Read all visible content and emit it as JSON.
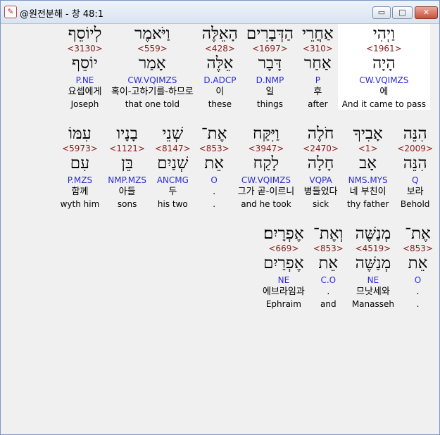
{
  "window": {
    "title": "@원전분해 - 창 48:1",
    "app_icon": "app-logo-icon",
    "min_icon": "minimize-icon",
    "max_icon": "maximize-icon",
    "close_icon": "close-icon",
    "min_glyph": "▭",
    "max_glyph": "□",
    "close_glyph": "✕"
  },
  "rows": [
    {
      "words": [
        {
          "heb": "וַיְהִי",
          "strong": "<1961>",
          "lex": "הָיָה",
          "morph": "CW.VQIMZS",
          "ko": "에",
          "en": "And it came to pass"
        },
        {
          "heb": "אַחֲרֵי",
          "strong": "<310>",
          "lex": "אַחַר",
          "morph": "P",
          "ko": "후",
          "en": "after"
        },
        {
          "heb": "הַדְּבָרִים",
          "strong": "<1697>",
          "lex": "דָּבָר",
          "morph": "D.NMP",
          "ko": "일",
          "en": "things"
        },
        {
          "heb": "הָאֵלֶּה",
          "strong": "<428>",
          "lex": "אֵלֶּה",
          "morph": "D.ADCP",
          "ko": "이",
          "en": "these"
        },
        {
          "heb": "וַיֹּאמֶר",
          "strong": "<559>",
          "lex": "אָמַר",
          "morph": "CW.VQIMZS",
          "ko": "혹이-고하기를-하므로",
          "en": "that one told"
        },
        {
          "heb": "לְיוֹסֵף",
          "strong": "<3130>",
          "lex": "יוֹסֵף",
          "morph": "P.NE",
          "ko": "요셉에게",
          "en": "Joseph"
        }
      ]
    },
    {
      "words": [
        {
          "heb": "הִנֵּה",
          "strong": "<2009>",
          "lex": "הִנֵּה",
          "morph": "Q",
          "ko": "보라",
          "en": "Behold"
        },
        {
          "heb": "אָבִיךָ",
          "strong": "<1>",
          "lex": "אָב",
          "morph": "NMS.MYS",
          "ko": "네 부친이",
          "en": "thy father"
        },
        {
          "heb": "חֹלֶה",
          "strong": "<2470>",
          "lex": "חָלָה",
          "morph": "VQPA",
          "ko": "병들었다",
          "en": "sick"
        },
        {
          "heb": "וַיִּקַּח",
          "strong": "<3947>",
          "lex": "לָקַח",
          "morph": "CW.VQIMZS",
          "ko": "그가 곧-이르니",
          "en": "and he took"
        },
        {
          "heb": "אֶת־",
          "strong": "<853>",
          "lex": "אֵת",
          "morph": "O",
          "ko": ".",
          "en": "."
        },
        {
          "heb": "שְׁנֵי",
          "strong": "<8147>",
          "lex": "שְׁנַיִם",
          "morph": "ANCMG",
          "ko": "두",
          "en": "his two"
        },
        {
          "heb": "בָנָיו",
          "strong": "<1121>",
          "lex": "בֵּן",
          "morph": "NMP.MZS",
          "ko": "아들",
          "en": "sons"
        },
        {
          "heb": "עִמּוֹ",
          "strong": "<5973>",
          "lex": "עִם",
          "morph": "P.MZS",
          "ko": "함께",
          "en": "wyth him"
        }
      ]
    },
    {
      "words": [
        {
          "heb": "אֶת־",
          "strong": "<853>",
          "lex": "אֵת",
          "morph": "O",
          "ko": ".",
          "en": "."
        },
        {
          "heb": "מְנַשֶּׁה",
          "strong": "<4519>",
          "lex": "מְנַשֶּׁה",
          "morph": "NE",
          "ko": "므낫세와",
          "en": "Manasseh"
        },
        {
          "heb": "וְאֶת־",
          "strong": "<853>",
          "lex": "אֵת",
          "morph": "C.O",
          "ko": ".",
          "en": "and"
        },
        {
          "heb": "אֶפְרָיִם׃",
          "strong": "<669>",
          "lex": "אֶפְרַיִם",
          "morph": "NE",
          "ko": "에브라임과",
          "en": "Ephraim"
        }
      ]
    }
  ]
}
